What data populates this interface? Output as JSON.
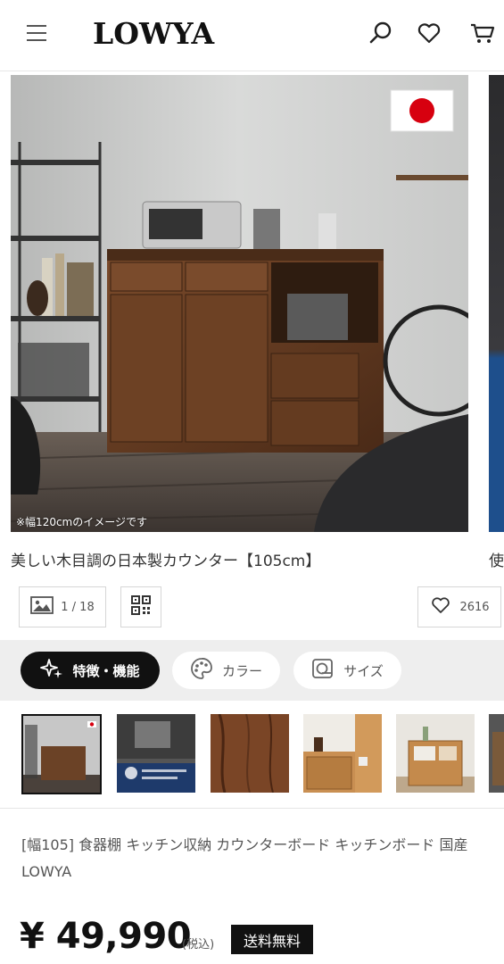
{
  "header": {
    "logo": "LOWYA",
    "icons": [
      "menu-icon",
      "search-icon",
      "heart-icon",
      "cart-icon"
    ]
  },
  "gallery": {
    "caption": "※幅120cmのイメージです",
    "product_title": "美しい木目調の日本製カウンター【105cm】",
    "next_title_peek": "使",
    "image_count": "1 / 18",
    "favorite_count": "2616"
  },
  "tabs": [
    {
      "label": "特徴・機能",
      "icon": "sparkle-icon",
      "active": true
    },
    {
      "label": "カラー",
      "icon": "palette-icon",
      "active": false
    },
    {
      "label": "サイズ",
      "icon": "ruler-icon",
      "active": false
    }
  ],
  "product": {
    "title": "[幅105] 食器棚 キッチン収納 カウンターボード キッチンボード 国産 LOWYA",
    "price": "¥ 49,990",
    "tax_note": "(税込)",
    "shipping_badge": "送料無料"
  },
  "colors": {
    "accent": "#111111",
    "flag_red": "#d7000f",
    "wood": "#6b4226"
  }
}
